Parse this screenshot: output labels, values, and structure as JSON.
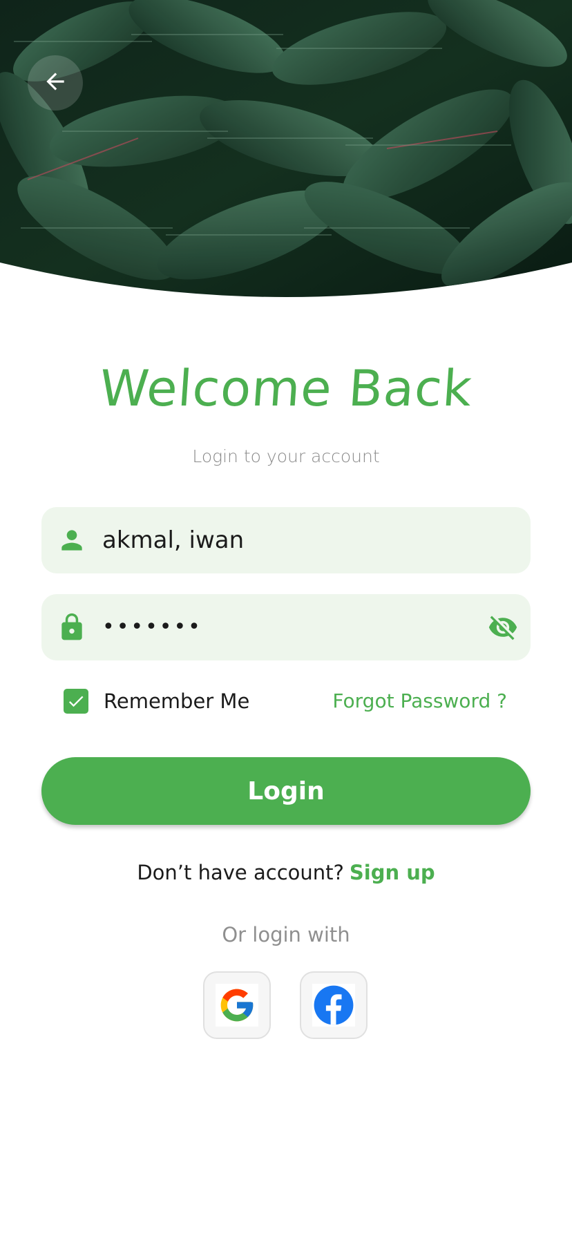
{
  "header": {
    "back_icon": "arrow-left-icon",
    "image_subject": "dark green leaves with water droplets"
  },
  "heading": {
    "title": "Welcome Back",
    "subtitle": "Login to your account"
  },
  "form": {
    "username": {
      "icon": "person-icon",
      "value": "akmal, iwan"
    },
    "password": {
      "icon": "lock-icon",
      "value": "•••••••",
      "toggle_icon": "eye-off-icon"
    },
    "remember_me": {
      "label": "Remember Me",
      "checked": true
    },
    "forgot_password": "Forgot Password ?",
    "login_button": "Login"
  },
  "signup": {
    "prompt": "Don’t have account?",
    "link": "Sign up"
  },
  "social": {
    "label": "Or login with",
    "providers": [
      {
        "name": "Google",
        "icon": "google-icon"
      },
      {
        "name": "Facebook",
        "icon": "facebook-icon"
      }
    ]
  },
  "colors": {
    "accent": "#4caf50",
    "field_background": "#eef6ec",
    "muted_text": "#8a8a8a"
  }
}
